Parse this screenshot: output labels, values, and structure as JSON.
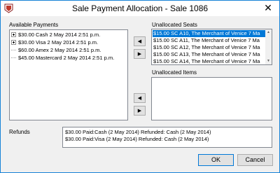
{
  "window": {
    "title": "Sale Payment Allocation - Sale 1086",
    "close_glyph": "✕"
  },
  "available_payments": {
    "label": "Available Payments",
    "items": [
      {
        "text": "$30.00 Cash 2 May 2014 2:51 p.m.",
        "expandable": true
      },
      {
        "text": "$30.00 Visa 2 May 2014 2:51 p.m.",
        "expandable": true
      },
      {
        "text": "$60.00 Amex 2 May 2014 2:51 p.m.",
        "expandable": false
      },
      {
        "text": "$45.00 Mastercard 2 May 2014 2:51 p.m.",
        "expandable": false
      }
    ]
  },
  "unallocated_seats": {
    "label": "Unallocated Seats",
    "items": [
      "$15.00 SC A10, The Merchant of Venice 7 Ma",
      "$15.00 SC A11, The Merchant of Venice 7 Ma",
      "$15.00 SC A12, The Merchant of Venice 7 Ma",
      "$15.00 SC A13, The Merchant of Venice 7 Ma",
      "$15.00 SC A14, The Merchant of Venice 7 Ma"
    ],
    "selected_index": 0
  },
  "unallocated_items": {
    "label": "Unallocated Items"
  },
  "arrows": {
    "left": "◀",
    "right": "▶",
    "up": "▲",
    "down": "▼"
  },
  "refunds": {
    "label": "Refunds",
    "lines": [
      "$30.00 Paid:Cash (2 May 2014) Refunded: Cash (2 May 2014)",
      "$30.00 Paid:Visa (2 May 2014) Refunded: Cash (2 May 2014)"
    ]
  },
  "buttons": {
    "ok": "OK",
    "cancel": "Cancel"
  },
  "colors": {
    "selection": "#0078d7",
    "window_border": "#1883d7"
  }
}
